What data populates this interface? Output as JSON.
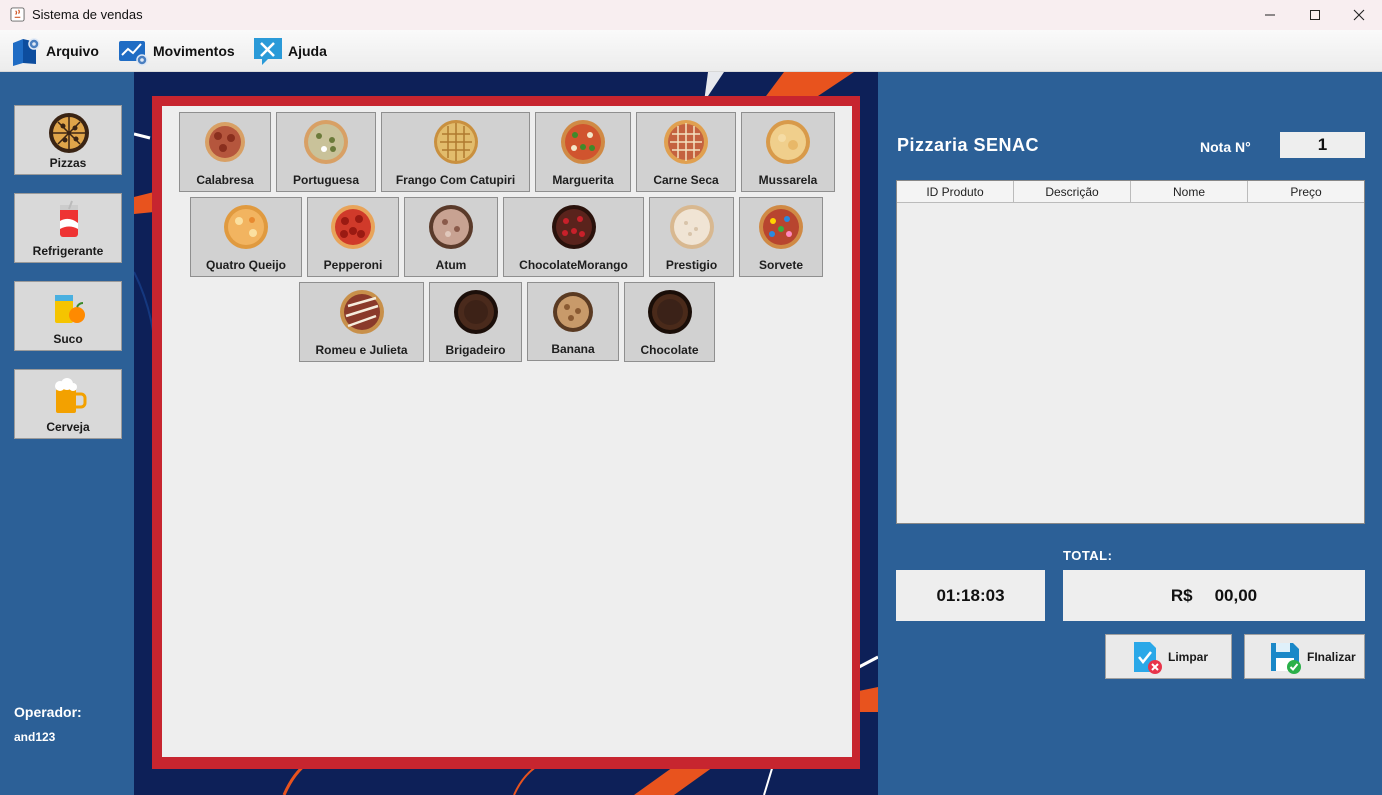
{
  "window": {
    "title": "Sistema de vendas"
  },
  "menu": [
    {
      "label": "Arquivo",
      "icon": "folder-gear-icon"
    },
    {
      "label": "Movimentos",
      "icon": "chart-gear-icon"
    },
    {
      "label": "Ajuda",
      "icon": "tools-help-icon"
    }
  ],
  "categories": [
    {
      "label": "Pizzas",
      "icon": "pizza-icon"
    },
    {
      "label": "Refrigerante",
      "icon": "soda-can-icon"
    },
    {
      "label": "Suco",
      "icon": "juice-icon"
    },
    {
      "label": "Cerveja",
      "icon": "beer-mug-icon"
    }
  ],
  "operator": {
    "label": "Operador:",
    "name": "and123"
  },
  "products": [
    {
      "label": "Calabresa",
      "color": "#b5563d"
    },
    {
      "label": "Portuguesa",
      "color": "#b8b074"
    },
    {
      "label": "Frango Com Catupiri",
      "color": "#d8b463"
    },
    {
      "label": "Marguerita",
      "color": "#c95a36"
    },
    {
      "label": "Carne Seca",
      "color": "#c4623f"
    },
    {
      "label": "Mussarela",
      "color": "#e8c07a"
    },
    {
      "label": "Quatro Queijo",
      "color": "#eba85a"
    },
    {
      "label": "Pepperoni",
      "color": "#c0322b"
    },
    {
      "label": "Atum",
      "color": "#b0897a"
    },
    {
      "label": "ChocolateMorango",
      "color": "#5a231c"
    },
    {
      "label": "Prestigio",
      "color": "#e6d6c4"
    },
    {
      "label": "Sorvete",
      "color": "#b8452f"
    },
    {
      "label": "Romeu e Julieta",
      "color": "#8a3a2a"
    },
    {
      "label": "Brigadeiro",
      "color": "#3d2217"
    },
    {
      "label": "Banana",
      "color": "#b8875a"
    },
    {
      "label": "Chocolate",
      "color": "#3b2218"
    }
  ],
  "brand": "Pizzaria SENAC",
  "nota": {
    "label": "Nota N°",
    "value": "1"
  },
  "table": {
    "columns": [
      "ID Produto",
      "Descrição",
      "Nome",
      "Preço"
    ],
    "rows": []
  },
  "total": {
    "label": "TOTAL:",
    "currency": "R$",
    "value": "00,00"
  },
  "clock": "01:18:03",
  "actions": {
    "clear": "Limpar",
    "finish": "FInalizar"
  }
}
